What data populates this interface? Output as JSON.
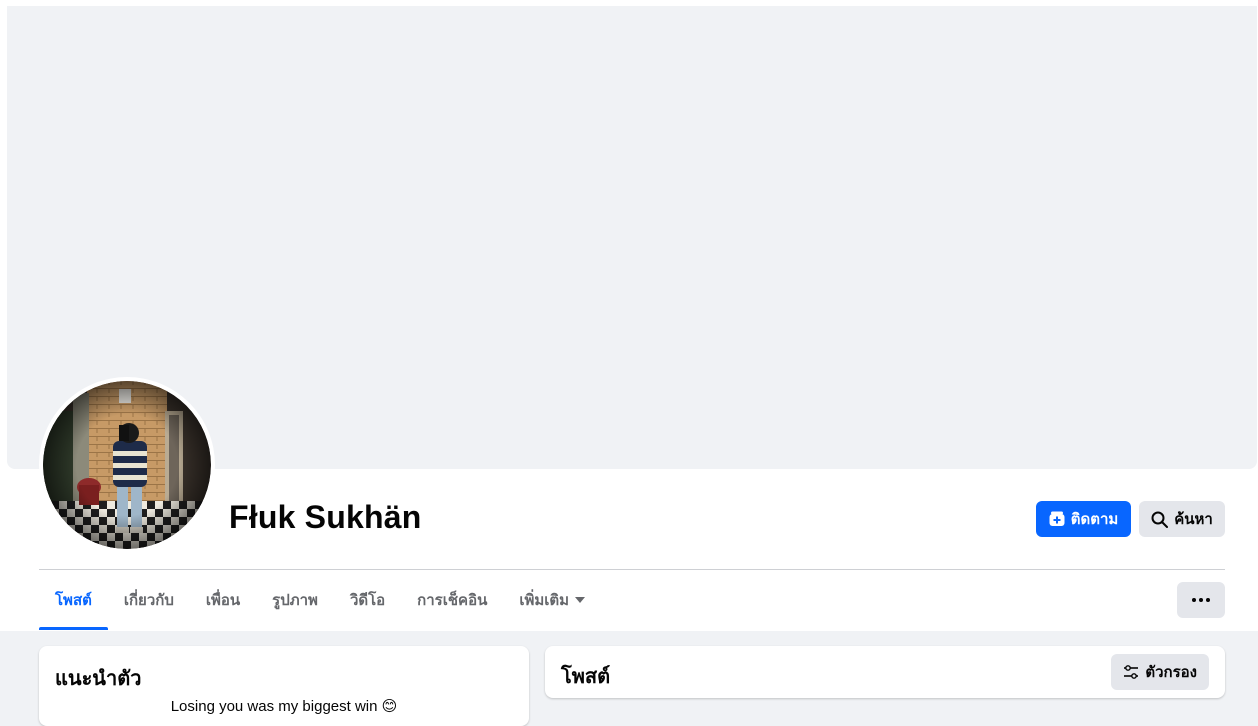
{
  "profile": {
    "name": "Fłuk Sukhän",
    "avatar_icon": "profile-photo"
  },
  "actions": {
    "follow_label": "ติดตาม",
    "follow_icon": "follow-plus-icon",
    "search_label": "ค้นหา",
    "search_icon": "search-icon"
  },
  "tabs": [
    {
      "label": "โพสต์",
      "active": true
    },
    {
      "label": "เกี่ยวกับ"
    },
    {
      "label": "เพื่อน"
    },
    {
      "label": "รูปภาพ"
    },
    {
      "label": "วิดีโอ"
    },
    {
      "label": "การเช็คอิน"
    },
    {
      "label": "เพิ่มเติม"
    }
  ],
  "intro": {
    "title": "แนะนำตัว",
    "bio": "Losing you was my biggest win 😊"
  },
  "posts": {
    "title": "โพสต์",
    "filter_label": "ตัวกรอง",
    "filter_icon": "filter-sliders-icon"
  },
  "colors": {
    "accent": "#0866ff",
    "page_bg": "#f0f2f5",
    "secondary_button": "#e4e6eb"
  }
}
